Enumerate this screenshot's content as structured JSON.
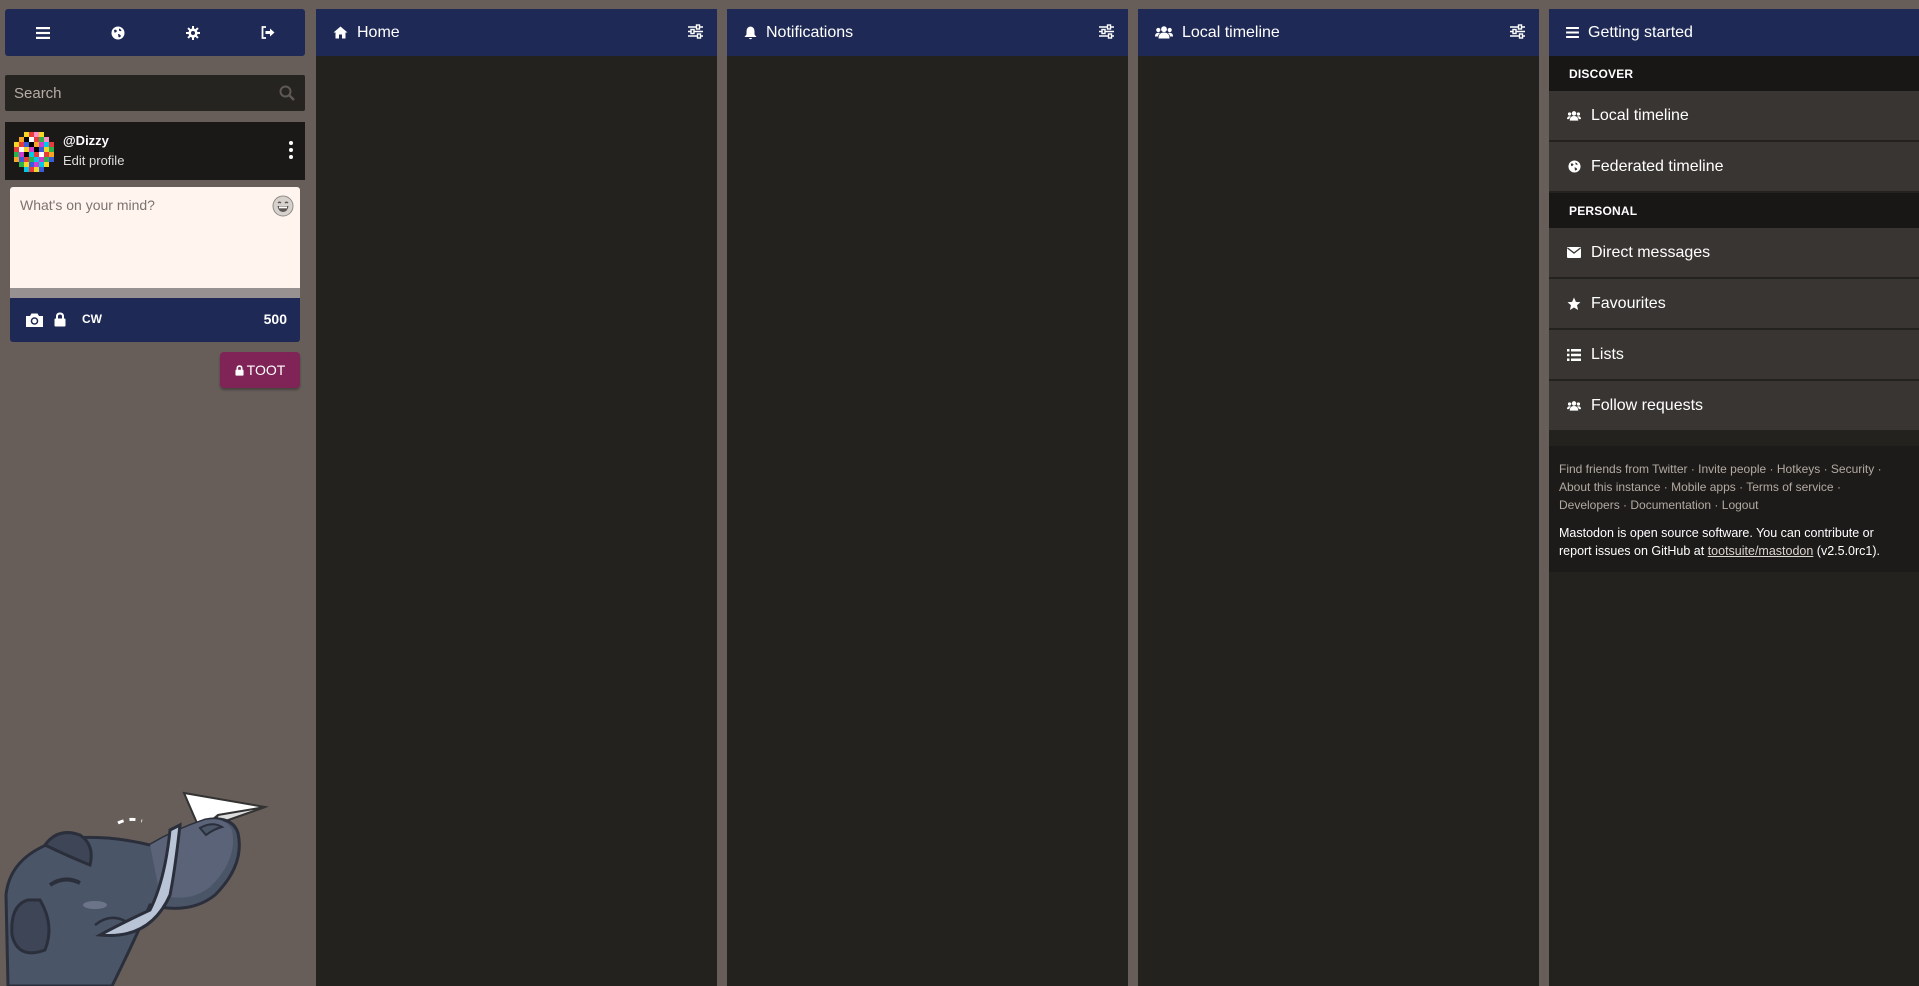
{
  "colors": {
    "header": "#1e2a55",
    "column_bg": "#24221f",
    "page_bg": "#675e5a",
    "toot_button": "#802457",
    "compose_bg": "#fff4ee"
  },
  "drawer": {
    "tabs": [
      {
        "icon": "hamburger-icon"
      },
      {
        "icon": "globe-icon"
      },
      {
        "icon": "gear-icon"
      },
      {
        "icon": "sign-out-icon"
      }
    ],
    "search": {
      "placeholder": "Search",
      "value": ""
    },
    "account": {
      "handle": "@Dizzy",
      "edit_label": "Edit profile"
    },
    "compose": {
      "placeholder": "What's on your mind?",
      "cw_label": "CW",
      "char_count": "500",
      "toot_label": "TOOT"
    }
  },
  "columns": [
    {
      "title": "Home",
      "icon": "home-icon"
    },
    {
      "title": "Notifications",
      "icon": "bell-icon"
    },
    {
      "title": "Local timeline",
      "icon": "users-icon"
    }
  ],
  "getting_started": {
    "title": "Getting started",
    "discover_heading": "DISCOVER",
    "discover_items": [
      {
        "label": "Local timeline",
        "icon": "users-icon"
      },
      {
        "label": "Federated timeline",
        "icon": "globe-icon"
      }
    ],
    "personal_heading": "PERSONAL",
    "personal_items": [
      {
        "label": "Direct messages",
        "icon": "envelope-icon"
      },
      {
        "label": "Favourites",
        "icon": "star-icon"
      },
      {
        "label": "Lists",
        "icon": "list-icon"
      },
      {
        "label": "Follow requests",
        "icon": "users-icon"
      }
    ],
    "footer_links": [
      "Find friends from Twitter",
      "Invite people",
      "Hotkeys",
      "Security",
      "About this instance",
      "Mobile apps",
      "Terms of service",
      "Developers",
      "Documentation",
      "Logout"
    ],
    "about_prefix": "Mastodon is open source software. You can contribute or report issues on GitHub at ",
    "about_link": "tootsuite/mastodon",
    "about_suffix": " (v2.5.0rc1)."
  }
}
